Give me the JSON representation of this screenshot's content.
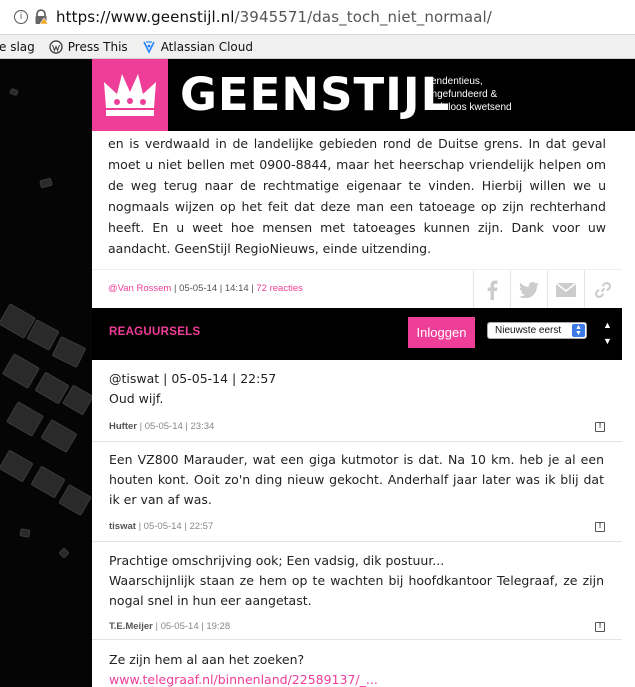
{
  "browser": {
    "url_host": "https://www.geenstijl.nl",
    "url_path": "/3945571/das_toch_niet_normaal/",
    "bookmarks": [
      {
        "label": "e slag",
        "icon": "none"
      },
      {
        "label": "Press This",
        "icon": "wordpress-icon"
      },
      {
        "label": "Atlassian Cloud",
        "icon": "atlassian-icon"
      }
    ]
  },
  "site": {
    "brand": "GEENSTIJL",
    "tagline_1": "Tendentieus,",
    "tagline_2": "ongefundeerd &",
    "tagline_3": "nodeloos kwetsend",
    "accent": "#ef3e98"
  },
  "article": {
    "body": "en is verdwaald in de landelijke gebieden rond de Duitse grens. In dat geval moet u niet bellen met 0900-8844, maar het heerschap vriendelijk helpen om de weg terug naar de rechtmatige eigenaar te vinden. Hierbij willen we u nogmaals wijzen op het feit dat deze man een tatoeage op zijn rechterhand heeft. En u weet hoe mensen met tatoeages kunnen zijn. Dank voor uw aandacht. GeenStijl RegioNieuws, einde uitzending.",
    "author": "@Van Rossem",
    "date": "05-05-14",
    "time": "14:14",
    "reactions": "72 reacties",
    "sep": "|"
  },
  "comments_header": {
    "title": "REAGUURSELS",
    "login_label": "Inloggen",
    "sort_value": "Nieuwste eerst"
  },
  "comments": [
    {
      "line1": "@tiswat | 05-05-14 | 22:57",
      "line2": "Oud wijf.",
      "author": "Hufter",
      "meta": "| 05-05-14 | 23:34"
    },
    {
      "text": "Een VZ800 Marauder, wat een giga kutmotor is dat. Na 10 km. heb je al een houten kont. Ooit zo'n ding nieuw gekocht. Anderhalf jaar later was ik blij dat ik er van af was.",
      "author": "tiswat",
      "meta": "| 05-05-14 | 22:57"
    },
    {
      "line1": "Prachtige omschrijving ook; Een vadsig, dik postuur...",
      "text": "Waarschijnlijk staan ze hem op te wachten bij hoofdkantoor Telegraaf, ze zijn nogal snel in hun eer aangetast.",
      "author": "T.E.Meijer",
      "meta": "| 05-05-14 | 19:28"
    },
    {
      "line1": "Ze zijn hem al aan het zoeken?",
      "link": "www.telegraaf.nl/binnenland/22589137/_..."
    }
  ],
  "report_glyph": "!"
}
